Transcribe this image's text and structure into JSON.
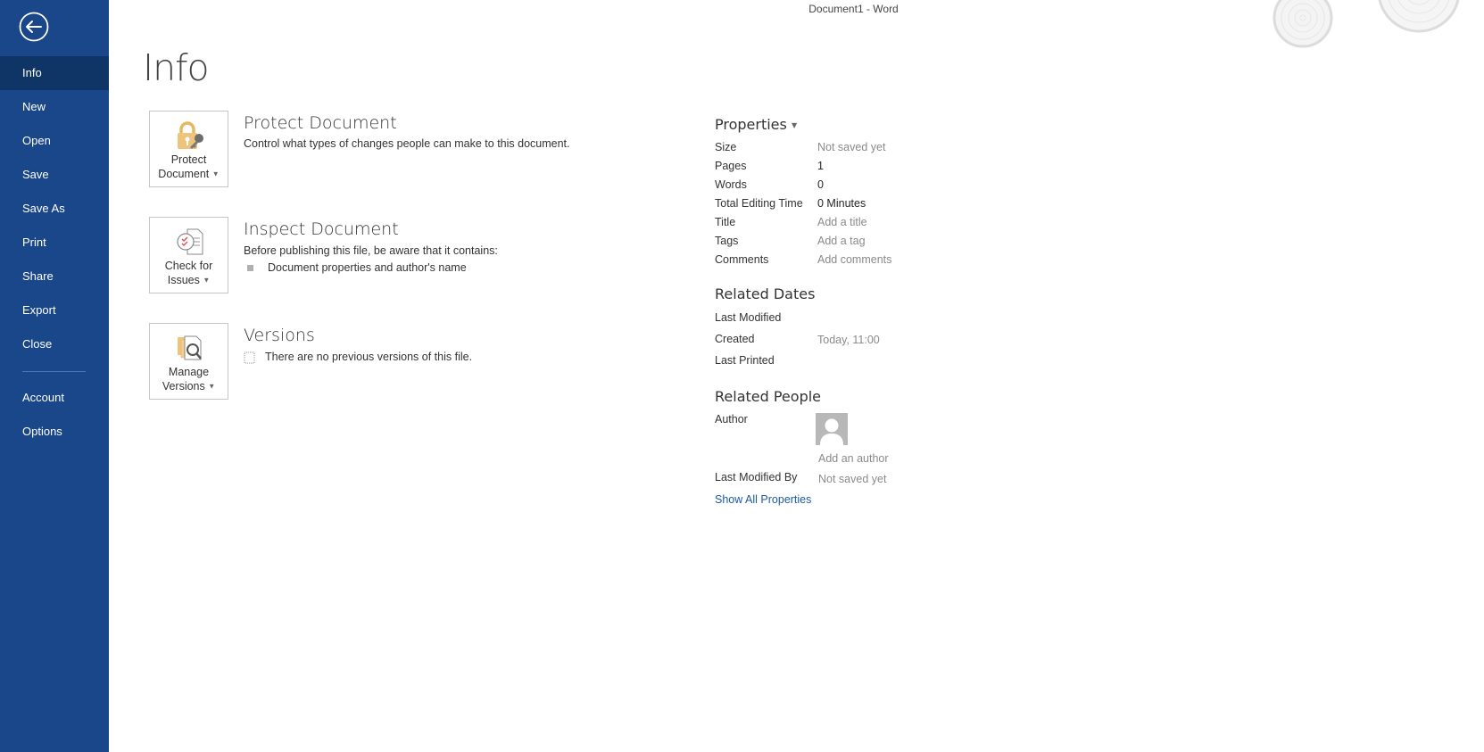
{
  "window": {
    "title": "Document1 - Word"
  },
  "sidebar": {
    "back_icon": "back-arrow-circle-icon",
    "items": [
      {
        "label": "Info",
        "active": true
      },
      {
        "label": "New"
      },
      {
        "label": "Open"
      },
      {
        "label": "Save"
      },
      {
        "label": "Save As"
      },
      {
        "label": "Print"
      },
      {
        "label": "Share"
      },
      {
        "label": "Export"
      },
      {
        "label": "Close"
      }
    ],
    "bottom_items": [
      {
        "label": "Account"
      },
      {
        "label": "Options"
      }
    ],
    "colors": {
      "background": "#19478a",
      "active": "#0f3566"
    }
  },
  "page": {
    "title": "Info"
  },
  "sections": {
    "protect": {
      "button_line1": "Protect",
      "button_line2": "Document",
      "icon": "lock-key-icon",
      "title": "Protect Document",
      "description": "Control what types of changes people can make to this document."
    },
    "inspect": {
      "button_line1": "Check for",
      "button_line2": "Issues",
      "icon": "inspect-document-icon",
      "title": "Inspect Document",
      "description": "Before publishing this file, be aware that it contains:",
      "bullets": [
        "Document properties and author's name"
      ]
    },
    "versions": {
      "button_line1": "Manage",
      "button_line2": "Versions",
      "icon": "manage-versions-icon",
      "title": "Versions",
      "description": "There are no previous versions of this file."
    }
  },
  "properties": {
    "heading": "Properties",
    "rows": [
      {
        "label": "Size",
        "value": "Not saved yet",
        "muted": true
      },
      {
        "label": "Pages",
        "value": "1"
      },
      {
        "label": "Words",
        "value": "0"
      },
      {
        "label": "Total Editing Time",
        "value": "0 Minutes"
      },
      {
        "label": "Title",
        "value": "Add a title",
        "muted": true
      },
      {
        "label": "Tags",
        "value": "Add a tag",
        "muted": true
      },
      {
        "label": "Comments",
        "value": "Add comments",
        "muted": true
      }
    ]
  },
  "related_dates": {
    "heading": "Related Dates",
    "rows": [
      {
        "label": "Last Modified",
        "value": ""
      },
      {
        "label": "Created",
        "value": "Today, 11:00"
      },
      {
        "label": "Last Printed",
        "value": ""
      }
    ]
  },
  "related_people": {
    "heading": "Related People",
    "author_label": "Author",
    "add_author": "Add an author",
    "last_modified_by_label": "Last Modified By",
    "last_modified_by_value": "Not saved yet"
  },
  "show_all_properties": "Show All Properties"
}
